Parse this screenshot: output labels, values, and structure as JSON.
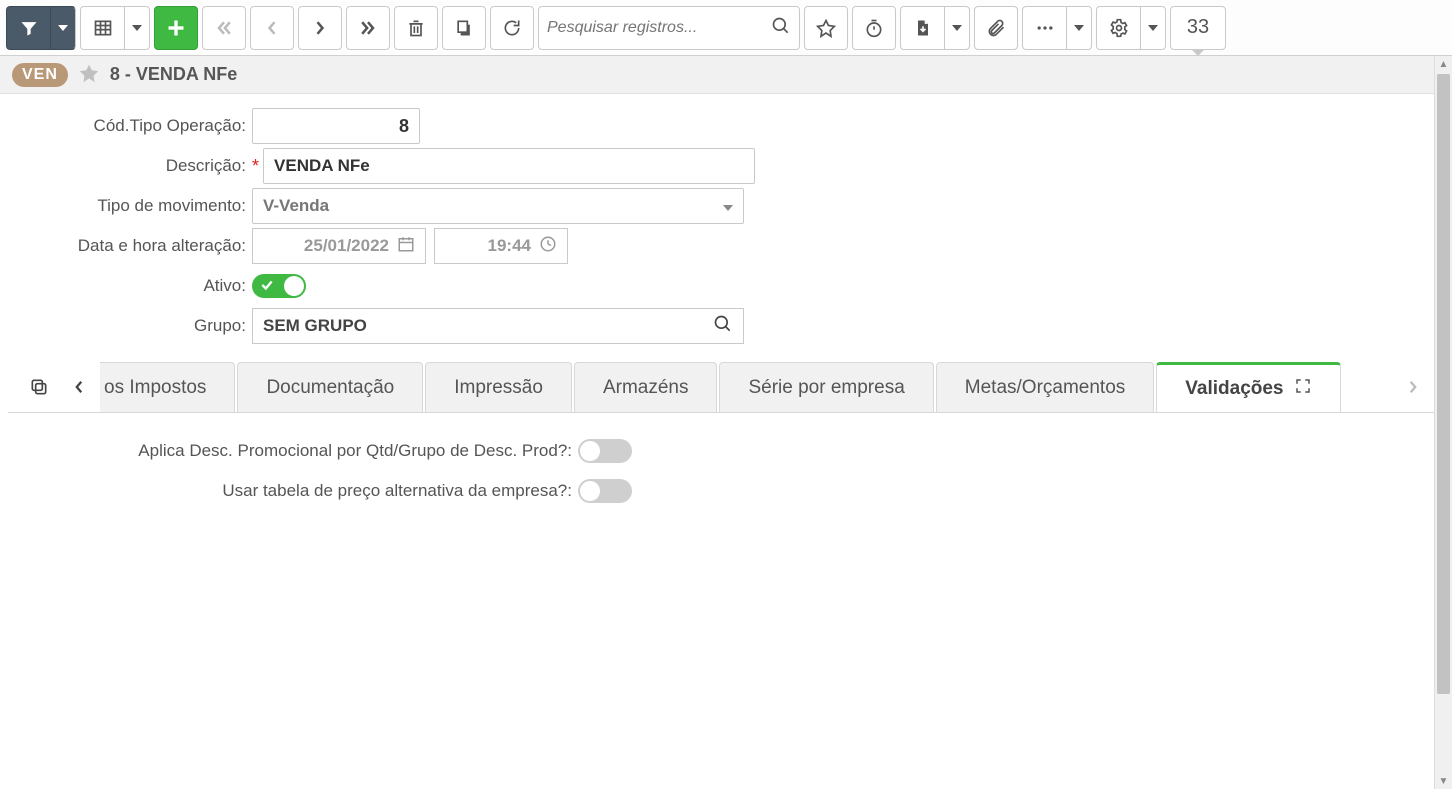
{
  "toolbar": {
    "search_placeholder": "Pesquisar registros...",
    "record_count": "33"
  },
  "breadcrumb": {
    "badge": "VEN",
    "title": "8 - VENDA NFe"
  },
  "form": {
    "cod_label": "Cód.Tipo Operação:",
    "cod_value": "8",
    "descricao_label": "Descrição:",
    "descricao_value": "VENDA NFe",
    "tipo_mov_label": "Tipo de movimento:",
    "tipo_mov_value": "V-Venda",
    "data_label": "Data e hora alteração:",
    "data_value": "25/01/2022",
    "hora_value": "19:44",
    "ativo_label": "Ativo:",
    "grupo_label": "Grupo:",
    "grupo_value": "SEM GRUPO"
  },
  "tabs": {
    "0": "os Impostos",
    "1": "Documentação",
    "2": "Impressão",
    "3": "Armazéns",
    "4": "Série por empresa",
    "5": "Metas/Orçamentos",
    "6": "Validações"
  },
  "validations": {
    "desc_promo_label": "Aplica Desc. Promocional por Qtd/Grupo de Desc. Prod?:",
    "preco_alt_label": "Usar tabela de preço alternativa da empresa?:"
  }
}
